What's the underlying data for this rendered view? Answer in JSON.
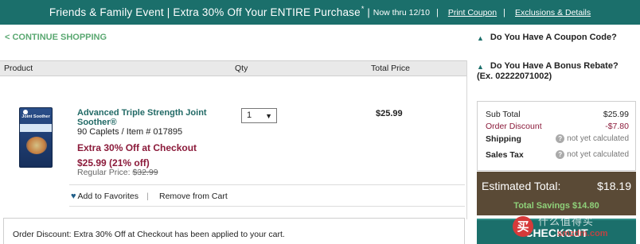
{
  "promo": {
    "main": "Friends & Family Event | Extra 30% Off Your ENTIRE Purchase",
    "star": "*",
    "sep": "|",
    "dates": "Now thru 12/10",
    "sep2": "|",
    "print_coupon": "Print Coupon",
    "sep3": "|",
    "exclusions": "Exclusions & Details"
  },
  "nav": {
    "continue": "< CONTINUE SHOPPING"
  },
  "cart": {
    "headers": {
      "product": "Product",
      "qty": "Qty",
      "total": "Total Price"
    },
    "item": {
      "name": "Advanced Triple Strength Joint Soother®",
      "details": "90 Caplets / Item # 017895",
      "promo": "Extra 30% Off at Checkout",
      "price": "$25.99 (21% off)",
      "regular_label": "Regular Price:",
      "regular_value": "$32.99",
      "qty": "1",
      "qty_arrow": "▼",
      "line_total": "$25.99",
      "thumb_text": "Joint Soother"
    },
    "actions": {
      "favorite": "Add to Favorites",
      "divider": "|",
      "remove": "Remove from Cart"
    },
    "notice": "Order Discount: Extra 30% Off at Checkout has been applied to your cart."
  },
  "sidebar": {
    "coupon": "Do You Have A Coupon Code?",
    "rebate": "Do You Have A Bonus Rebate?",
    "rebate_example": "(Ex. 02222071002)"
  },
  "summary": {
    "subtotal_label": "Sub Total",
    "subtotal_value": "$25.99",
    "discount_label": "Order Discount",
    "discount_value": "-$7.80",
    "shipping_label": "Shipping",
    "shipping_value": "not yet calculated",
    "tax_label": "Sales Tax",
    "tax_value": "not yet calculated",
    "help_glyph": "?",
    "estimated_label": "Estimated Total:",
    "estimated_value": "$18.19",
    "savings": "Total Savings $14.80",
    "checkout": "CHECKOUT"
  },
  "watermark": {
    "seal": "买",
    "text": "什么值得买",
    "url": "smzdm.com"
  },
  "colors": {
    "brand_teal": "#1b6f6b",
    "accent_green": "#5aa871",
    "discount_red": "#8b1a3a",
    "estimate_bg": "#5a4a36"
  },
  "icons": {
    "favorite": "heart-icon",
    "section_toggle": "triangle-up-icon",
    "help": "question-icon",
    "dropdown": "chevron-down-icon"
  }
}
